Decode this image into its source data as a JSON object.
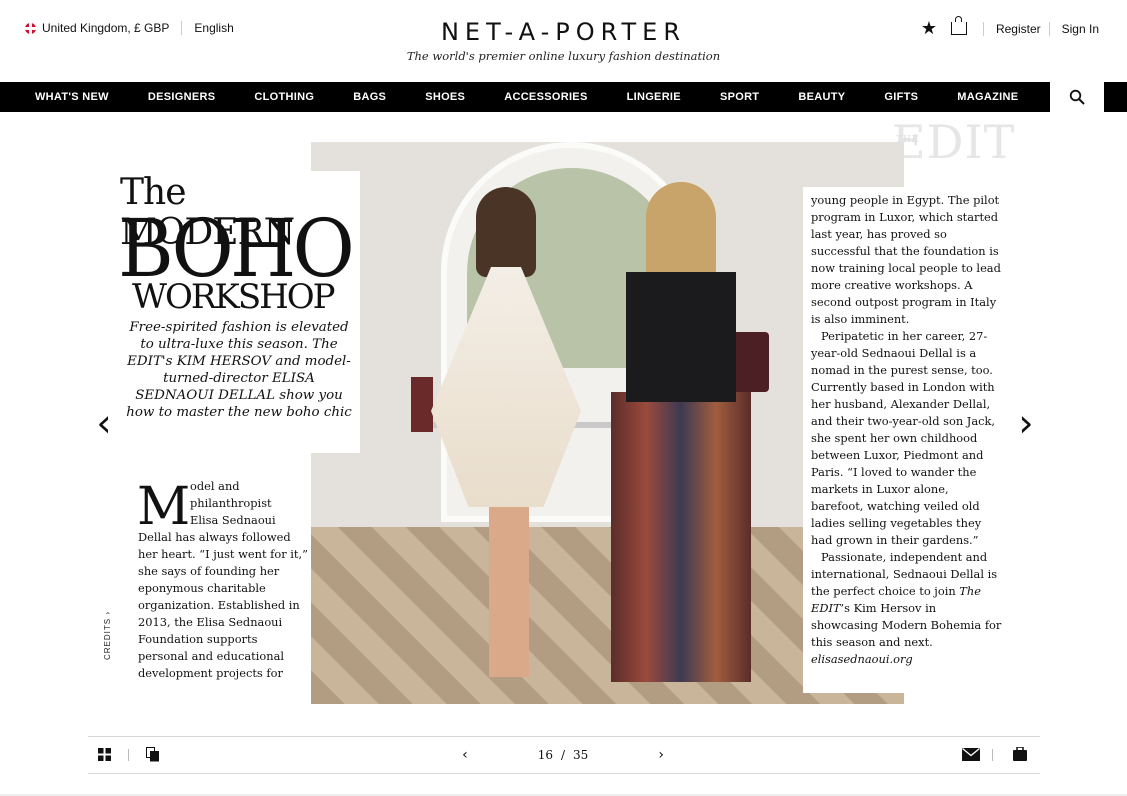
{
  "header": {
    "locale": "United Kingdom, £ GBP",
    "language": "English",
    "brand": "NET-A-PORTER",
    "tagline": "The world's premier online luxury fashion destination",
    "register": "Register",
    "sign_in": "Sign In"
  },
  "icons": {
    "flag": "uk-flag-icon",
    "wishlist": "star-icon",
    "bag": "shopping-bag-icon",
    "search": "search-icon",
    "grid": "grid-icon",
    "pages": "pages-icon",
    "mail": "mail-icon",
    "briefcase": "briefcase-icon"
  },
  "nav": {
    "items": [
      "WHAT'S NEW",
      "DESIGNERS",
      "CLOTHING",
      "BAGS",
      "SHOES",
      "ACCESSORIES",
      "LINGERIE",
      "SPORT",
      "BEAUTY",
      "GIFTS",
      "MAGAZINE"
    ]
  },
  "magazine": {
    "edit_mark": "EDIT",
    "edit_mark_small": "THE",
    "title_line1": "The MODERN",
    "title_line2": "BOHO",
    "title_line3": "WORKSHOP",
    "dek": "Free-spirited fashion is elevated to ultra-luxe this season. The EDIT's KIM HERSOV and model-turned-director ELISA SEDNAOUI DELLAL show you how to master the new boho chic",
    "dropcap": "M",
    "left_col_indent1": "odel and",
    "left_col_indent2": "philanthropist",
    "left_col_indent3": "Elisa Sednaoui",
    "left_col_body": "Dellal has always followed her heart. “I just went for it,” she says of founding her eponymous charitable organization. Established in 2013, the Elisa Sednaoui Foundation supports personal and educational development projects for",
    "right_col_p1": "young people in Egypt. The pilot program in Luxor, which started last year, has proved so successful that the foundation is now training local people to lead more creative workshops. A second outpost program in Italy is also imminent.",
    "right_col_p2": "Peripatetic in her career, 27-year-old Sednaoui Dellal is a nomad in the purest sense, too. Currently based in London with her husband, Alexander Dellal, and their two-year-old son Jack, she spent her own childhood between Luxor, Piedmont and Paris. “I loved to wander the markets in Luxor alone, barefoot, watching veiled old ladies selling vegetables they had grown in their gardens.”",
    "right_col_p3a": "Passionate, independent and international, Sednaoui Dellal is the perfect choice to join ",
    "right_col_p3_em": "The EDIT",
    "right_col_p3b": "’s Kim Hersov in showcasing Modern Bohemia for this season and next. ",
    "right_col_link": "elisasednaoui.org",
    "credits": "CREDITS ›",
    "prev_arrow": "‹",
    "next_arrow": "›"
  },
  "footer": {
    "current_page": "16",
    "slash": "/",
    "total_pages": "35",
    "prev": "‹",
    "next": "›"
  }
}
